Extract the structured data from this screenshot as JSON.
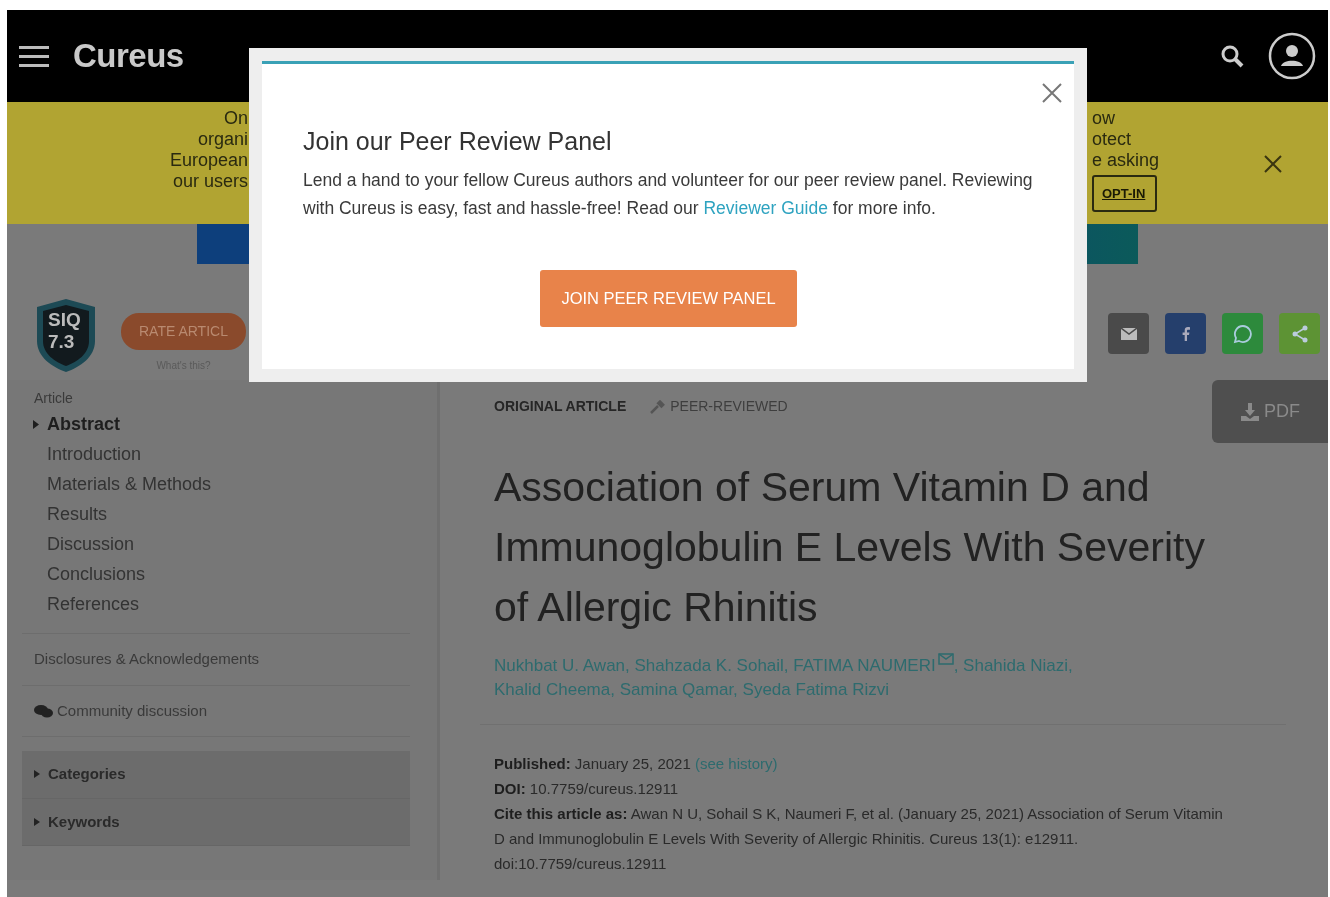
{
  "header": {
    "logo": "Cureus"
  },
  "banner": {
    "left_lines": [
      "On",
      "organi",
      "European",
      "our users"
    ],
    "right_lines": [
      "ow",
      "otect",
      "e asking"
    ],
    "optin": "OPT-IN"
  },
  "article_bar": {
    "siq_label": "SIQ",
    "siq_score": "7.3",
    "rate_button": "RATE ARTICL",
    "whats_this": "What's this?"
  },
  "sidebar": {
    "heading": "Article",
    "items": [
      {
        "label": "Abstract",
        "selected": true
      },
      {
        "label": "Introduction",
        "selected": false
      },
      {
        "label": "Materials & Methods",
        "selected": false
      },
      {
        "label": "Results",
        "selected": false
      },
      {
        "label": "Discussion",
        "selected": false
      },
      {
        "label": "Conclusions",
        "selected": false
      },
      {
        "label": "References",
        "selected": false
      }
    ],
    "disclosures": "Disclosures & Acknowledgements",
    "community": "Community discussion",
    "sections": [
      {
        "label": "Categories",
        "expanded": false
      },
      {
        "label": "Keywords",
        "expanded": false
      }
    ]
  },
  "article": {
    "type": "ORIGINAL ARTICLE",
    "review": "PEER-REVIEWED",
    "pdf": "PDF",
    "title": "Association of Serum Vitamin D and Immunoglobulin E Levels With Severity of Allergic Rhinitis",
    "authors": [
      {
        "name": "Nukhbat U. Awan",
        "corresponding": false
      },
      {
        "name": "Shahzada K. Sohail",
        "corresponding": false
      },
      {
        "name": "FATIMA NAUMERI",
        "corresponding": true
      },
      {
        "name": "Shahida Niazi",
        "corresponding": false
      },
      {
        "name": "Khalid Cheema",
        "corresponding": false
      },
      {
        "name": "Samina Qamar",
        "corresponding": false
      },
      {
        "name": "Syeda Fatima Rizvi",
        "corresponding": false
      }
    ],
    "author_separator": ",",
    "published": {
      "text": "**Published:** January 25, 2021",
      "link": "(see history)"
    },
    "doi": "**DOI:** 10.7759/cureus.12911",
    "cite": "**Cite this article as:** Awan N U, Sohail S K, Naumeri F, et al. (January 25, 2021) Association of Serum Vitamin D and Immunoglobulin E Levels With Severity of Allergic Rhinitis. Cureus 13(1): e12911. doi:10.7759/cureus.12911"
  },
  "modal": {
    "title": "Join our Peer Review Panel",
    "body_before": "Lend a hand to your fellow Cureus authors and volunteer for our peer review panel. Reviewing with Cureus is easy, fast and hassle-free! Read our",
    "link": "Reviewer Guide",
    "body_after": "for more info.",
    "button": "JOIN PEER REVIEW PANEL"
  }
}
